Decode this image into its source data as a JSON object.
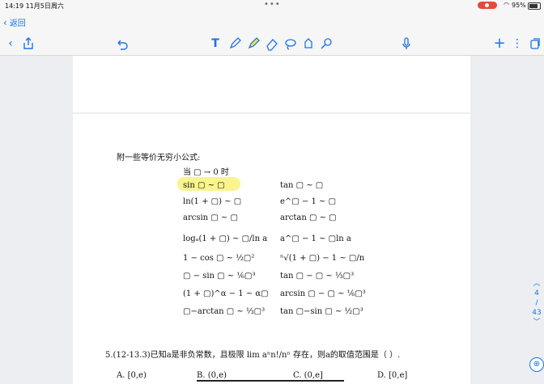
{
  "status": {
    "time": "14:19  11月5日周六",
    "battery": "95%"
  },
  "nav": {
    "back": "返回"
  },
  "doc": {
    "heading": "附一些等价无穷小公式:",
    "when": "当 ▢ → 0 时",
    "formulas_left": [
      "sin ▢ ~ ▢",
      "ln(1 + ▢) ~ ▢",
      "arcsin ▢ ~ ▢",
      "logₐ(1 + ▢) ~ ▢/ln a",
      "1 − cos ▢ ~ ½▢²",
      "▢ − sin ▢ ~ ⅙▢³",
      "(1 + ▢)^α − 1 ~ α▢",
      "▢−arctan ▢ ~ ⅓▢³"
    ],
    "formulas_right": [
      "tan ▢ ~ ▢",
      "e^▢ − 1 ~ ▢",
      "arctan ▢ ~ ▢",
      "a^▢ − 1 ~ ▢ln a",
      "ⁿ√(1 + ▢) − 1 ~ ▢/n",
      "tan ▢ − ▢ ~ ⅓▢³",
      "arcsin ▢ − ▢ ~ ⅙▢³",
      "tan ▢−sin ▢ ~ ½▢³"
    ],
    "question": "5.(12-13.3)已知a是非负常数，且极限 lim aⁿn!/nⁿ 存在，则a的取值范围是（      ）.",
    "options": [
      "A. [0,e)",
      "B. (0,e)",
      "C. (0,e]",
      "D. [0,e]"
    ]
  },
  "pager": {
    "current": "4",
    "total": "43"
  }
}
